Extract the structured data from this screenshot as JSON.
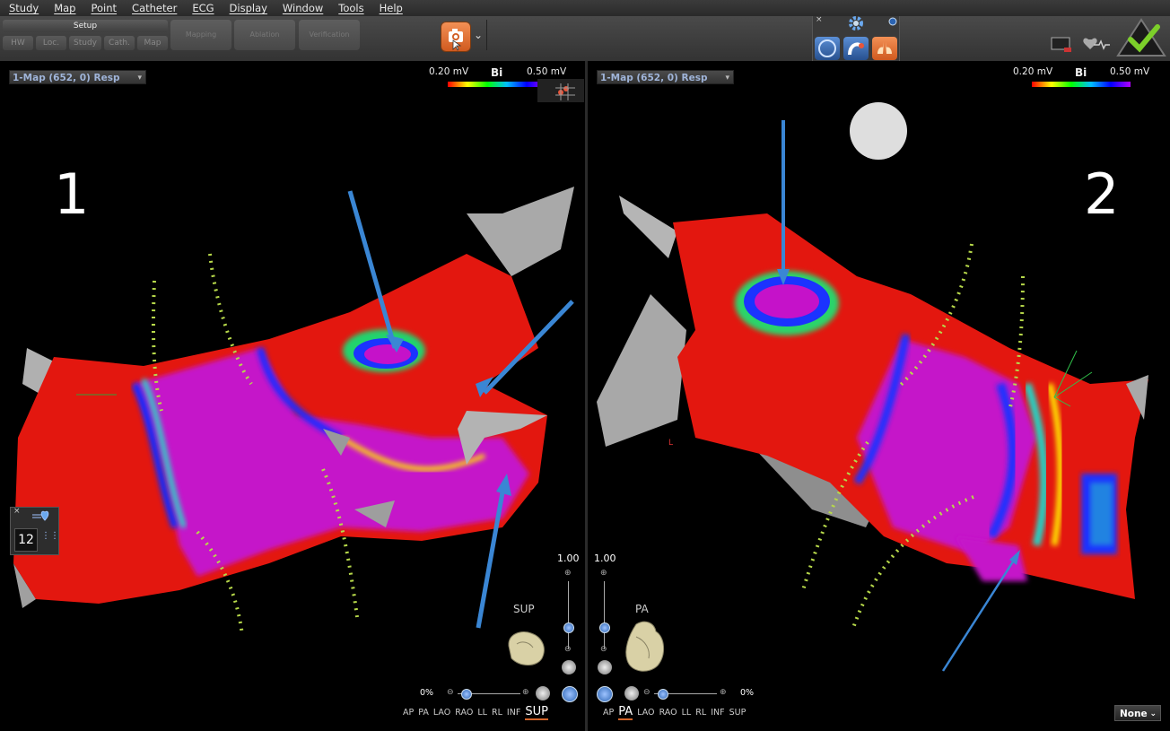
{
  "menu": [
    "Study",
    "Map",
    "Point",
    "Catheter",
    "ECG",
    "Display",
    "Window",
    "Tools",
    "Help"
  ],
  "toolbar": {
    "setup_label": "Setup",
    "setup_items": [
      "HW",
      "Loc.",
      "Study",
      "Cath.",
      "Map"
    ],
    "big_buttons": [
      "Mapping",
      "Ablation",
      "Verification"
    ],
    "camera_menu_chevron": "⌄"
  },
  "left_view": {
    "map_select": "1-Map (652, 0) Resp",
    "colorbar_min": "0.20 mV",
    "colorbar_title": "Bi",
    "colorbar_max": "0.50 mV",
    "panel_number": "1",
    "orientation_label": "SUP",
    "opacity_value": "1.00",
    "zoom_pct": "0%",
    "catheter_count": "12",
    "views": [
      "AP",
      "PA",
      "LAO",
      "RAO",
      "LL",
      "RL",
      "INF"
    ],
    "current_view": "SUP"
  },
  "right_view": {
    "map_select": "1-Map (652, 0) Resp",
    "colorbar_min": "0.20 mV",
    "colorbar_title": "Bi",
    "colorbar_max": "0.50 mV",
    "panel_number": "2",
    "orientation_label": "PA",
    "opacity_value": "1.00",
    "zoom_pct": "0%",
    "views_before": [
      "AP"
    ],
    "current_view": "PA",
    "views_after": [
      "LAO",
      "RAO",
      "LL",
      "RL",
      "INF",
      "SUP"
    ],
    "l_marker": "L"
  },
  "none_select": "None",
  "colors": {
    "accent": "#d2642a",
    "menu_text": "#e8e8e8",
    "map_select_text": "#9fb4d9",
    "arrow_blue": "#3a86d4",
    "dots_green": "#b7d94a"
  }
}
